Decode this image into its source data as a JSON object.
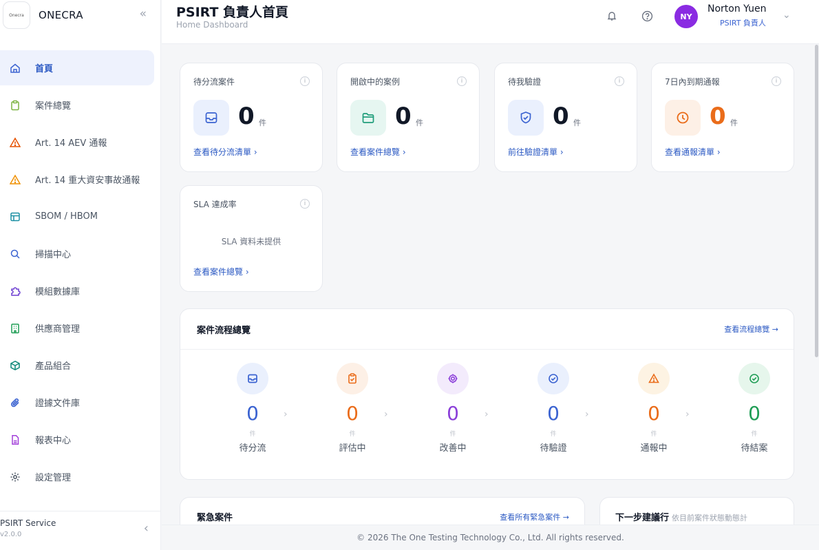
{
  "brand": {
    "name": "ONECRA",
    "logo_text": "Onecra"
  },
  "header": {
    "title": "PSIRT 負責人首頁",
    "subtitle": "Home Dashboard",
    "user": {
      "initials": "NY",
      "name": "Norton Yuen",
      "role": "PSIRT 負責人"
    }
  },
  "sidebar": {
    "items": [
      {
        "label": "首頁",
        "icon": "home-icon",
        "active": true
      },
      {
        "label": "案件總覽",
        "icon": "clipboard-icon"
      },
      {
        "label": "Art. 14 AEV 通報",
        "icon": "warning-icon"
      },
      {
        "label": "Art. 14 重大資安事故通報",
        "icon": "warning-icon"
      },
      {
        "label": "SBOM / HBOM",
        "icon": "table-icon"
      },
      {
        "label": "掃描中心",
        "icon": "search-icon"
      },
      {
        "label": "模組數據庫",
        "icon": "puzzle-icon"
      },
      {
        "label": "供應商管理",
        "icon": "building-icon"
      },
      {
        "label": "產品組合",
        "icon": "cube-icon"
      },
      {
        "label": "證據文件庫",
        "icon": "paperclip-icon"
      },
      {
        "label": "報表中心",
        "icon": "report-icon"
      },
      {
        "label": "設定管理",
        "icon": "gear-icon"
      }
    ],
    "footer": {
      "service": "PSIRT Service",
      "version": "v2.0.0"
    }
  },
  "stats": [
    {
      "title": "待分流案件",
      "value": "0",
      "unit": "件",
      "link": "查看待分流清單 ›",
      "icon": "inbox-icon"
    },
    {
      "title": "開啟中的案例",
      "value": "0",
      "unit": "件",
      "link": "查看案件總覽 ›",
      "icon": "folder-icon"
    },
    {
      "title": "待我驗證",
      "value": "0",
      "unit": "件",
      "link": "前往驗證清單 ›",
      "icon": "shield-check-icon"
    },
    {
      "title": "7日內到期通報",
      "value": "0",
      "unit": "件",
      "link": "查看通報清單 ›",
      "icon": "clock-icon"
    }
  ],
  "sla": {
    "title": "SLA 達成率",
    "message": "SLA 資料未提供",
    "link": "查看案件總覽 ›"
  },
  "flow": {
    "title": "案件流程總覽",
    "link": "查看流程總覽 →",
    "stages": [
      {
        "label": "待分流",
        "count": "0",
        "unit": "件",
        "color": "#3b63d1",
        "bg": "#eaf0fd",
        "icon": "inbox-icon"
      },
      {
        "label": "評估中",
        "count": "0",
        "unit": "件",
        "color": "#ea6c1a",
        "bg": "#fdf0e6",
        "icon": "clipboard-icon"
      },
      {
        "label": "改善中",
        "count": "0",
        "unit": "件",
        "color": "#8b3fd9",
        "bg": "#f3ebfc",
        "icon": "gear-icon"
      },
      {
        "label": "待驗證",
        "count": "0",
        "unit": "件",
        "color": "#3b63d1",
        "bg": "#eaf0fd",
        "icon": "check-circle-icon"
      },
      {
        "label": "通報中",
        "count": "0",
        "unit": "件",
        "color": "#ea6c1a",
        "bg": "#fdf3e3",
        "icon": "warning-icon"
      },
      {
        "label": "待結案",
        "count": "0",
        "unit": "件",
        "color": "#1f9d55",
        "bg": "#e6f6ec",
        "icon": "check-circle-icon"
      }
    ]
  },
  "urgent": {
    "title": "緊急案件",
    "link": "查看所有緊急案件 →"
  },
  "next_steps": {
    "title": "下一步建議行",
    "subtitle": "依目前案件狀態動態計"
  },
  "footer": {
    "copyright": "© 2026 The One Testing Technology Co., Ltd. All rights reserved."
  }
}
